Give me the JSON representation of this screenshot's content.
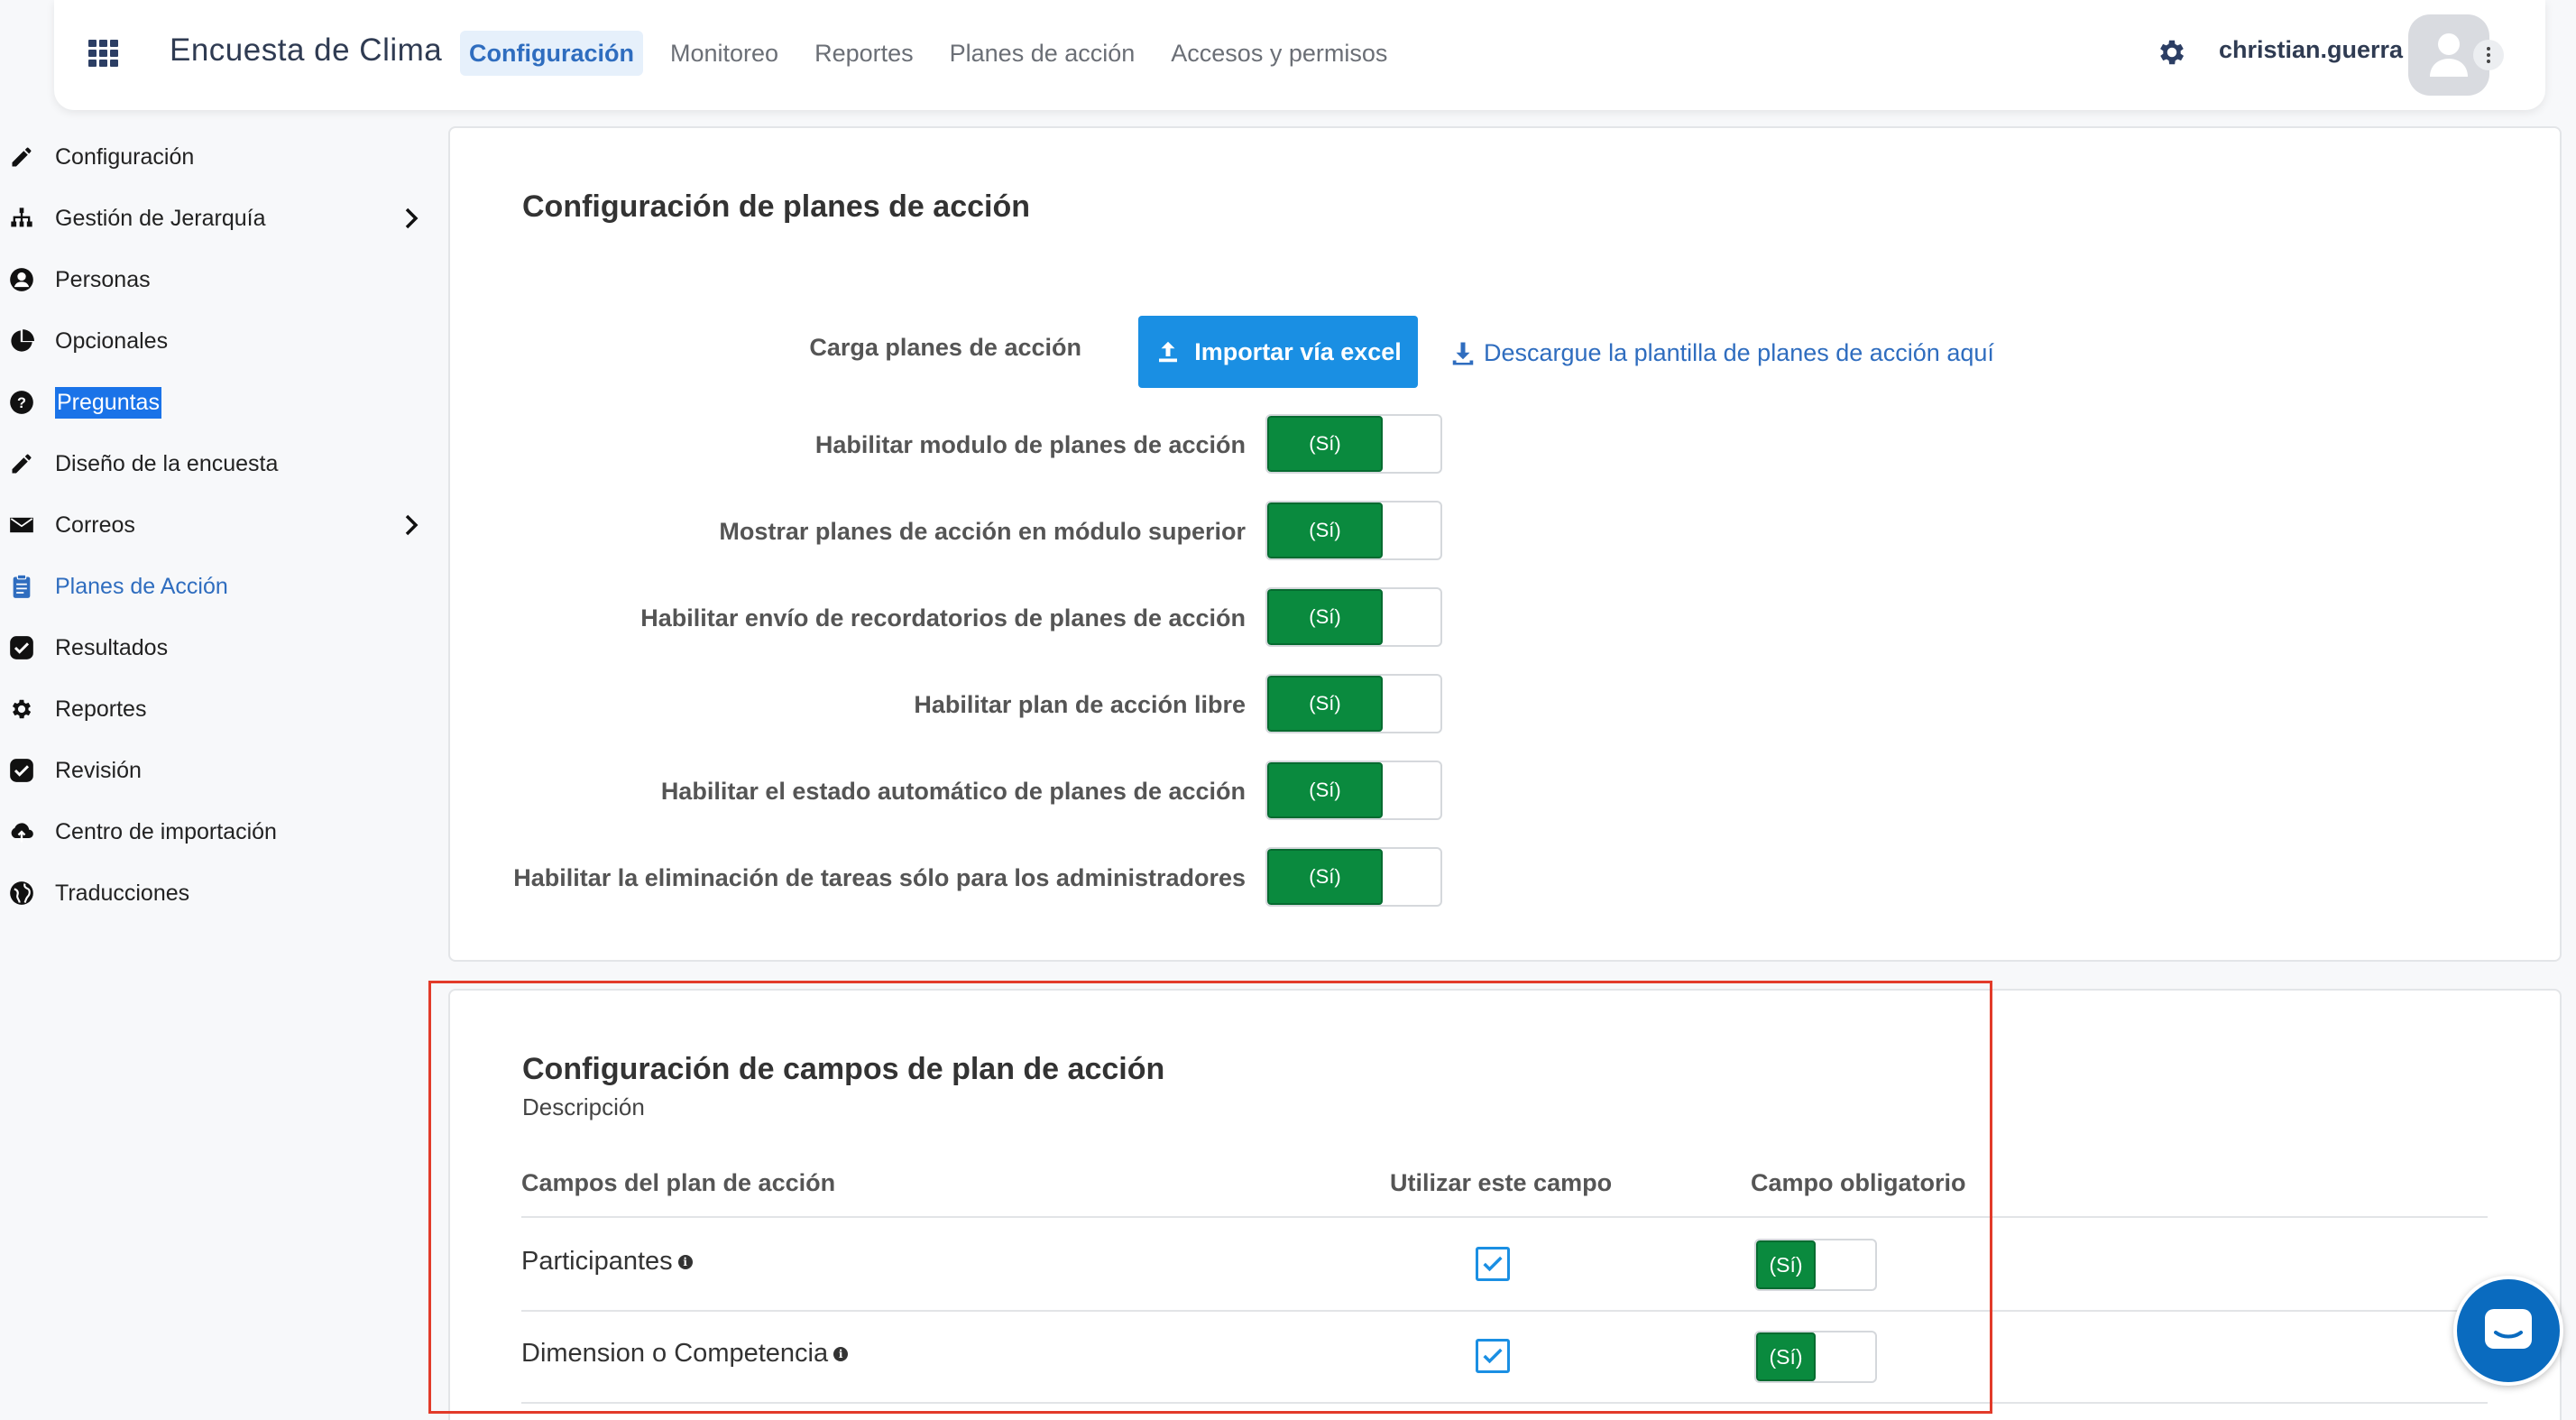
{
  "app": {
    "title": "Encuesta de Clima",
    "nav": [
      "Configuración",
      "Monitoreo",
      "Reportes",
      "Planes de acción",
      "Accesos y permisos"
    ],
    "active_nav": "Configuración",
    "username": "christian.guerra"
  },
  "sidebar": {
    "items": [
      {
        "label": "Configuración",
        "icon": "pencil-icon"
      },
      {
        "label": "Gestión de Jerarquía",
        "icon": "hierarchy-icon",
        "has_submenu": true
      },
      {
        "label": "Personas",
        "icon": "person-icon"
      },
      {
        "label": "Opcionales",
        "icon": "pie-chart-icon"
      },
      {
        "label": "Preguntas",
        "icon": "question-icon",
        "state": "text-selected"
      },
      {
        "label": "Diseño de la encuesta",
        "icon": "pencil-icon"
      },
      {
        "label": "Correos",
        "icon": "envelope-icon",
        "has_submenu": true
      },
      {
        "label": "Planes de Acción",
        "icon": "clipboard-icon",
        "state": "active"
      },
      {
        "label": "Resultados",
        "icon": "check-icon"
      },
      {
        "label": "Reportes",
        "icon": "gear-icon"
      },
      {
        "label": "Revisión",
        "icon": "check-icon"
      },
      {
        "label": "Centro de importación",
        "icon": "cloud-upload-icon"
      },
      {
        "label": "Traducciones",
        "icon": "globe-icon"
      }
    ]
  },
  "plans_config": {
    "title": "Configuración de planes de acción",
    "upload_label": "Carga planes de acción",
    "import_button": "Importar vía excel",
    "download_link": "Descargue la plantilla de planes de acción aquí",
    "toggles": [
      {
        "label": "Habilitar modulo de planes de acción",
        "value": "(Sí)"
      },
      {
        "label": "Mostrar planes de acción en módulo superior",
        "value": "(Sí)"
      },
      {
        "label": "Habilitar envío de recordatorios de planes de acción",
        "value": "(Sí)"
      },
      {
        "label": "Habilitar plan de acción libre",
        "value": "(Sí)"
      },
      {
        "label": "Habilitar el estado automático de planes de acción",
        "value": "(Sí)"
      },
      {
        "label": "Habilitar la eliminación de tareas sólo para los administradores",
        "value": "(Sí)"
      }
    ]
  },
  "fields_config": {
    "title": "Configuración de campos de plan de acción",
    "description": "Descripción",
    "columns": [
      "Campos del plan de acción",
      "Utilizar este campo",
      "Campo obligatorio"
    ],
    "rows": [
      {
        "name": "Participantes",
        "use": true,
        "required": "(Sí)"
      },
      {
        "name": "Dimension o Competencia",
        "use": true,
        "required": "(Sí)"
      }
    ]
  },
  "colors": {
    "accent": "#1a8fe3",
    "toggle_on": "#0a8a3e",
    "highlight": "#e23b2a"
  }
}
